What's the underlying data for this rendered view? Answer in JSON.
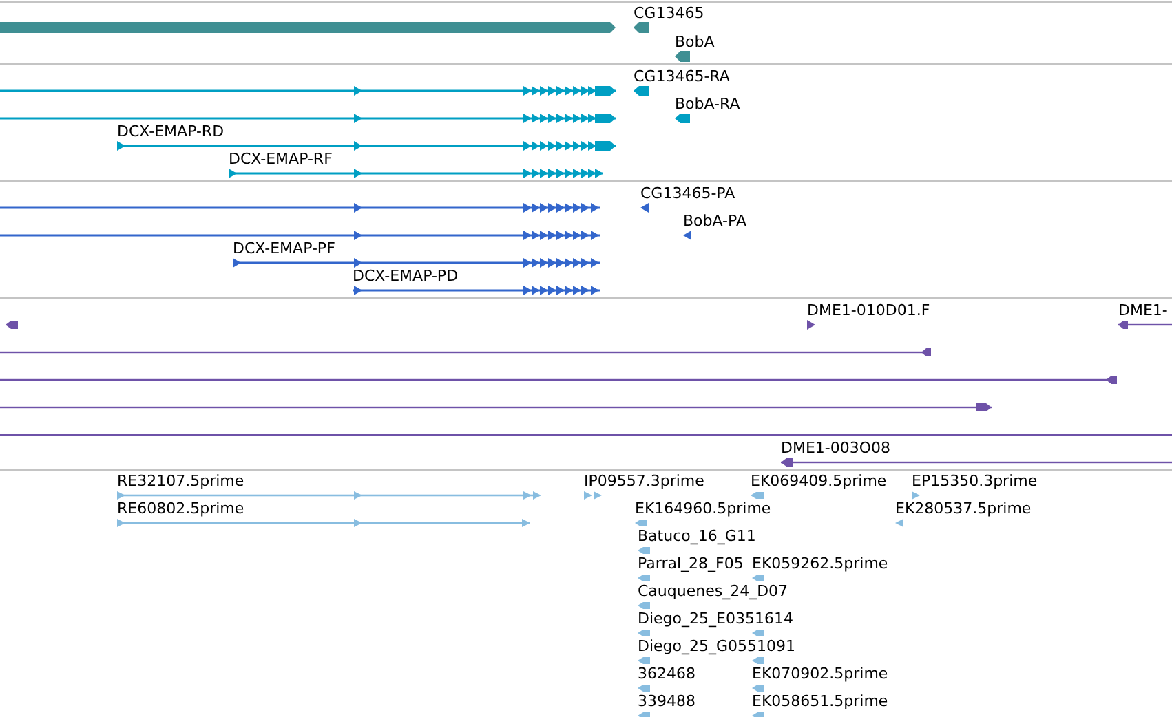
{
  "tracks": [
    {
      "kind": "gene",
      "color": "#3f8f93",
      "features": [
        {
          "reverse": false
        },
        {
          "label": "CG13465",
          "reverse": true
        },
        {
          "label": "BobA",
          "reverse": true
        }
      ]
    },
    {
      "kind": "transcript",
      "color": "#009fc3",
      "features": [
        {
          "reverse": false
        },
        {
          "label": "CG13465-RA",
          "reverse": true
        },
        {
          "reverse": false
        },
        {
          "label": "BobA-RA",
          "reverse": true
        },
        {
          "label": "DCX-EMAP-RD",
          "reverse": false
        },
        {
          "label": "DCX-EMAP-RF",
          "reverse": false
        }
      ]
    },
    {
      "kind": "protein",
      "color": "#3366cc",
      "features": [
        {
          "reverse": false
        },
        {
          "label": "CG13465-PA",
          "reverse": true
        },
        {
          "reverse": false
        },
        {
          "label": "BobA-PA",
          "reverse": true
        },
        {
          "label": "DCX-EMAP-PF",
          "reverse": false
        },
        {
          "label": "DCX-EMAP-PD",
          "reverse": false
        }
      ]
    },
    {
      "kind": "match",
      "color": "#6e52a8",
      "features": [
        {
          "reverse": true
        },
        {
          "label": "DME1-010D01.F",
          "reverse": false
        },
        {
          "label": "DME1-",
          "reverse": true
        },
        {
          "reverse": true
        },
        {
          "reverse": true
        },
        {
          "reverse": false
        },
        {
          "reverse": false
        },
        {
          "label": "DME1-003O08",
          "reverse": true
        }
      ]
    },
    {
      "kind": "read",
      "color": "#88bde0",
      "features": [
        {
          "label": "RE32107.5prime",
          "reverse": false
        },
        {
          "label": "IP09557.3prime",
          "reverse": false
        },
        {
          "label": "EK069409.5prime",
          "reverse": true
        },
        {
          "label": "EP15350.3prime",
          "reverse": false
        },
        {
          "label": "RE60802.5prime",
          "reverse": false
        },
        {
          "label": "EK164960.5prime",
          "reverse": true
        },
        {
          "label": "EK280537.5prime",
          "reverse": true
        },
        {
          "label": "Batuco_16_G11",
          "reverse": true
        },
        {
          "label": "Parral_28_F05",
          "reverse": true
        },
        {
          "label": "EK059262.5prime",
          "reverse": true
        },
        {
          "label": "Cauquenes_24_D07",
          "reverse": true
        },
        {
          "label": "Diego_25_E0351614",
          "reverse": true
        },
        {
          "reverse": true
        },
        {
          "label": "Diego_25_G0551091",
          "reverse": true
        },
        {
          "reverse": true
        },
        {
          "label": "362468",
          "reverse": true
        },
        {
          "label": "EK070902.5prime",
          "reverse": true
        },
        {
          "label": "339488",
          "reverse": true
        },
        {
          "label": "EK058651.5prime",
          "reverse": true
        }
      ]
    }
  ]
}
